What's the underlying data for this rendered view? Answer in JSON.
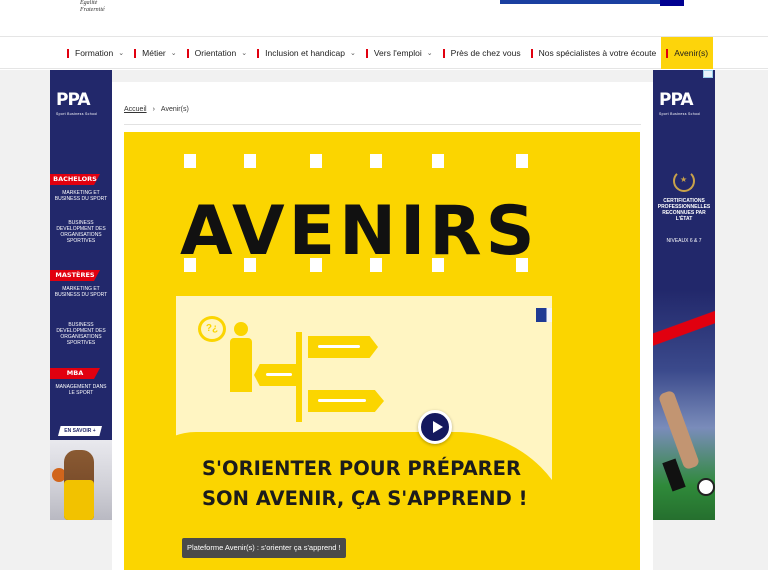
{
  "header": {
    "motto_line1": "Égalité",
    "motto_line2": "Fraternité"
  },
  "nav": {
    "items": [
      {
        "label": "Formation",
        "has_dropdown": true
      },
      {
        "label": "Métier",
        "has_dropdown": true
      },
      {
        "label": "Orientation",
        "has_dropdown": true
      },
      {
        "label": "Inclusion et handicap",
        "has_dropdown": true
      },
      {
        "label": "Vers l'emploi",
        "has_dropdown": true
      },
      {
        "label": "Près de chez vous",
        "has_dropdown": false
      },
      {
        "label": "Nos spécialistes à votre écoute",
        "has_dropdown": false
      },
      {
        "label": "Avenir(s)",
        "has_dropdown": false,
        "active": true
      }
    ],
    "chevron": "⌄"
  },
  "breadcrumb": {
    "home": "Accueil",
    "separator": "›",
    "current": "Avenir(s)"
  },
  "hero": {
    "title": "AVENIRS"
  },
  "video": {
    "headline_line1": "S'ORIENTER POUR PRÉPARER",
    "headline_line2": "SON AVENIR, ÇA S'APPREND !",
    "caption": "Plateforme Avenir(s) : s'orienter ça s'apprend !",
    "speech_bubble": "?¿"
  },
  "ad_left": {
    "brand": "PPA",
    "tagline": "Sport Business School",
    "label_bachelors": "BACHELORS",
    "bach_1": "Marketing et business du sport",
    "bach_2": "Business development des organisations sportives",
    "label_masteres": "MASTÈRES",
    "mast_1": "Marketing et business du sport",
    "mast_2": "Business development des organisations sportives",
    "label_mba": "MBA",
    "mba_1": "Management dans le sport",
    "cta": "EN SAVOIR +"
  },
  "ad_right": {
    "brand": "PPA",
    "tagline": "Sport Business School",
    "cert_text": "Certifications professionnelles reconnues par l'État",
    "levels": "Niveaux 6 & 7"
  },
  "colors": {
    "accent_yellow": "#fbd500",
    "republic_red": "#e1000f",
    "navy": "#22286b"
  }
}
